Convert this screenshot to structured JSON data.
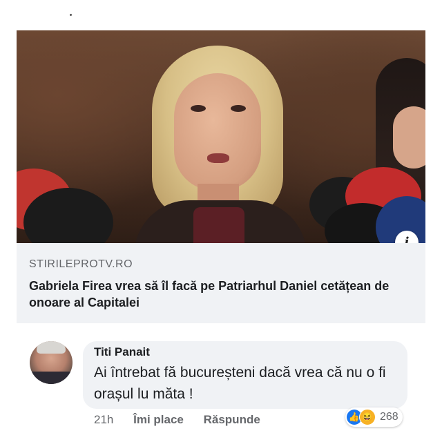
{
  "post": {
    "source": "STIRILEPROTV.RO",
    "headline": "Gabriela Firea vrea să îl facă pe Patriarhul Daniel cetățean de onoare al Capitalei",
    "info_icon": "i"
  },
  "comment": {
    "author": "Titi Panait",
    "text": "Ai întrebat fă bucureșteni dacă vrea că nu o fi orașul lu măta !",
    "time": "21h",
    "like_label": "Îmi place",
    "reply_label": "Răspunde",
    "reactions": {
      "icons": [
        "like-icon",
        "haha-icon"
      ],
      "count": "268"
    }
  },
  "colors": {
    "facebook_blue": "#1877f2",
    "bubble_bg": "#f0f2f5",
    "secondary_text": "#65676b"
  }
}
